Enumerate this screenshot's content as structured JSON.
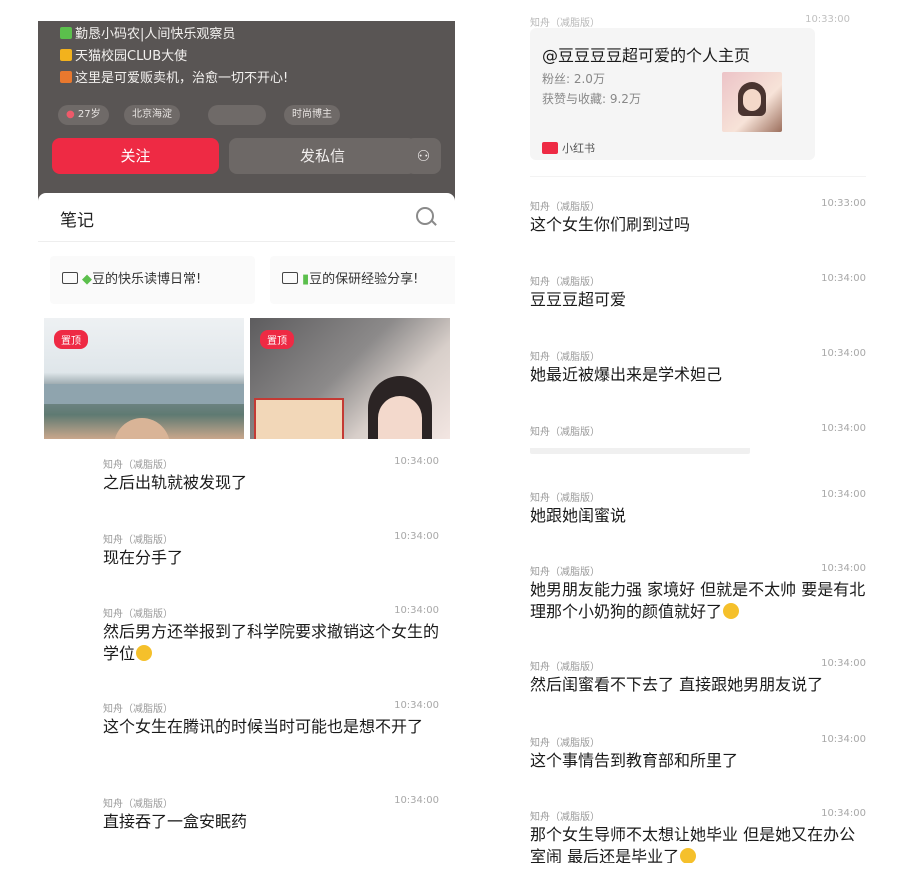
{
  "profile": {
    "bio": [
      "勤恳小码农|人间快乐观察员",
      "天猫校园CLUB大使",
      "这里是可爱贩卖机，治愈一切不开心!"
    ],
    "tags": [
      "27岁",
      "北京海淀",
      "时尚博主"
    ],
    "follow": "关注",
    "dm": "发私信",
    "notes_title": "笔记",
    "collections": [
      "豆的快乐读博日常!",
      "豆的保研经验分享!"
    ],
    "pinned": "置顶"
  },
  "share_card": {
    "header_src": "知舟（减脂版）",
    "header_time": "10:33:00",
    "title": "@豆豆豆豆超可爱的个人主页",
    "fans": "粉丝: 2.0万",
    "likes": "获赞与收藏: 9.2万",
    "app": "小红书"
  },
  "chat_b": [
    {
      "src": "知舟（减脂版）",
      "time": "10:33:00",
      "text": "这个女生你们刷到过吗"
    },
    {
      "src": "知舟（减脂版）",
      "time": "10:34:00",
      "text": "豆豆豆超可爱"
    },
    {
      "src": "知舟（减脂版）",
      "time": "10:34:00",
      "text": "她最近被爆出来是学术妲己"
    },
    {
      "src": "知舟（减脂版）",
      "time": "10:34:00",
      "text": ""
    }
  ],
  "chat_c": [
    {
      "src": "知舟（减脂版）",
      "time": "10:34:00",
      "text": "之后出轨就被发现了"
    },
    {
      "src": "知舟（减脂版）",
      "time": "10:34:00",
      "text": "现在分手了"
    },
    {
      "src": "知舟（减脂版）",
      "time": "10:34:00",
      "text": "然后男方还举报到了科学院要求撤销这个女生的学位"
    },
    {
      "src": "知舟（减脂版）",
      "time": "10:34:00",
      "text": "这个女生在腾讯的时候当时可能也是想不开了"
    },
    {
      "src": "知舟（减脂版）",
      "time": "10:34:00",
      "text": "直接吞了一盒安眠药"
    }
  ],
  "chat_d": [
    {
      "src": "知舟（减脂版）",
      "time": "10:34:00",
      "text": "她跟她闺蜜说"
    },
    {
      "src": "知舟（减脂版）",
      "time": "10:34:00",
      "text": "她男朋友能力强 家境好 但就是不太帅 要是有北理那个小奶狗的颜值就好了"
    },
    {
      "src": "知舟（减脂版）",
      "time": "10:34:00",
      "text": "然后闺蜜看不下去了 直接跟她男朋友说了"
    },
    {
      "src": "知舟（减脂版）",
      "time": "10:34:00",
      "text": "这个事情告到教育部和所里了"
    },
    {
      "src": "知舟（减脂版）",
      "time": "10:34:00",
      "text": "那个女生导师不太想让她毕业 但是她又在办公室闹 最后还是毕业了"
    }
  ],
  "colors": {
    "accent": "#ee2a44",
    "header_bg": "#595554"
  }
}
